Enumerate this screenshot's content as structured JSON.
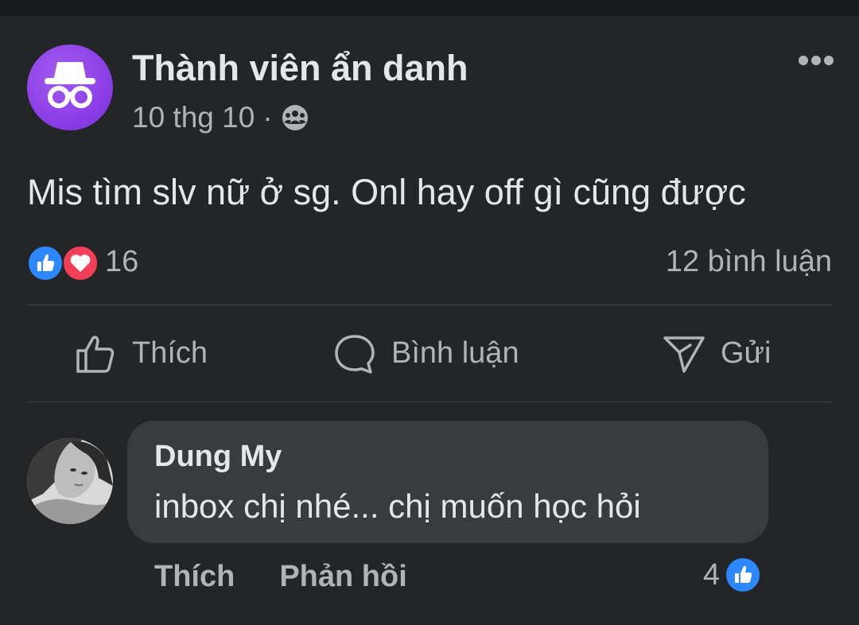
{
  "post": {
    "author": "Thành viên ẩn danh",
    "timestamp": "10 thg 10",
    "separator": "·",
    "audience_icon": "group-icon",
    "text": "Mis tìm slv nữ ở sg. Onl hay off gì cũng được",
    "reaction_count": "16",
    "comment_count": "12 bình luận",
    "reaction_icons": [
      "like-reaction-icon",
      "love-reaction-icon"
    ]
  },
  "actions": {
    "like_label": "Thích",
    "comment_label": "Bình luận",
    "send_label": "Gửi"
  },
  "comment": {
    "author": "Dung My",
    "text": "inbox chị nhé... chị muốn học hỏi",
    "like_label": "Thích",
    "reply_label": "Phản hồi",
    "reaction_count": "4"
  },
  "colors": {
    "background": "#242526",
    "anon_avatar": "#8c3fe6",
    "like_blue": "#2d88ff",
    "love_red": "#f33e58",
    "bubble": "#3a3b3c"
  }
}
